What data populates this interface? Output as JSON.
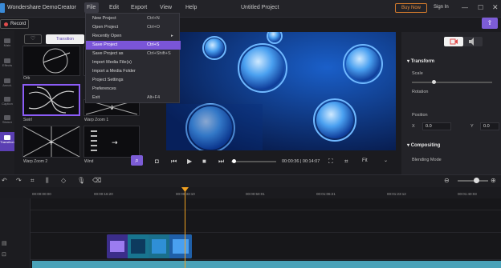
{
  "app": {
    "title": "Wondershare DemoCreator",
    "doc_title": "Untitled Project"
  },
  "menubar": {
    "file": "File",
    "edit": "Edit",
    "export": "Export",
    "view": "View",
    "help": "Help"
  },
  "titlebar": {
    "buy_now": "Buy Now",
    "sign_in": "Sign In",
    "min": "—",
    "max": "☐",
    "close": "✕"
  },
  "record": {
    "label": "Record"
  },
  "left_rail": {
    "items": [
      "Main",
      "Effects",
      "Annot.",
      "Caption",
      "Sticker",
      "Transition"
    ]
  },
  "media": {
    "transition_tab": "Transition",
    "thumbs": [
      {
        "label": "Orb"
      },
      {
        "label": "Swirl"
      },
      {
        "label": "Warp Zoom 1"
      },
      {
        "label": "Warp Zoom 2"
      },
      {
        "label": "Wind"
      }
    ]
  },
  "file_menu": {
    "items": [
      {
        "label": "New Project",
        "shortcut": "Ctrl+N"
      },
      {
        "label": "Open Project",
        "shortcut": "Ctrl+O"
      },
      {
        "label": "Recently Open",
        "shortcut": ""
      },
      {
        "label": "Save Project",
        "shortcut": "Ctrl+S"
      },
      {
        "label": "Save Project as",
        "shortcut": "Ctrl+Shift+S"
      },
      {
        "label": "Import Media File(s)",
        "shortcut": ""
      },
      {
        "label": "Import a Media Folder",
        "shortcut": ""
      },
      {
        "label": "Project Settings",
        "shortcut": ""
      },
      {
        "label": "Preferences",
        "shortcut": ""
      },
      {
        "label": "Exit",
        "shortcut": "Alt+F4"
      }
    ],
    "submenu_arrow": "▸"
  },
  "player": {
    "time": "00:00:36 | 00:14:07",
    "fit": "Fit",
    "progress_fraction": 0.03
  },
  "properties": {
    "transform": "Transform",
    "scale": "Scale",
    "rotation": "Rotation",
    "position": "Position",
    "x_label": "X",
    "x_value": "0.0",
    "y_label": "Y",
    "y_value": "0.0",
    "compositing": "Compositing",
    "blending_mode": "Blending Mode"
  },
  "timeline": {
    "ticks": [
      "00:00:00:00",
      "00:00:16:20",
      "00:00:33:10",
      "00:00:50:01",
      "00:01:06:21",
      "00:01:23:12",
      "00:01:40:03"
    ]
  },
  "colors": {
    "accent": "#7a55d8",
    "playhead": "#f0a020",
    "buy_now": "#e68a3a"
  }
}
